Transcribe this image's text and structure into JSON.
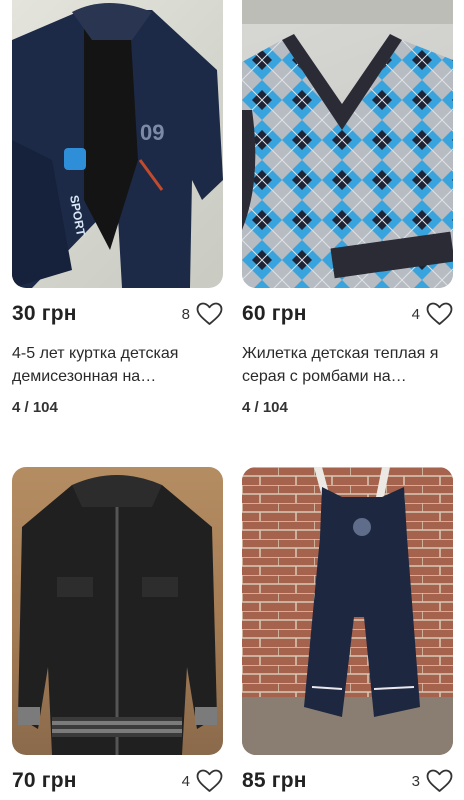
{
  "listings": [
    {
      "price": "30 грн",
      "likes": "8",
      "title": "4-5 лет куртка детская демисезонная на…",
      "size": "4 / 104",
      "image_icon": "jacket-sport-photo",
      "colors": {
        "garment": "#1c2a47",
        "accent": "#2f8ed8",
        "lining": "#141414"
      }
    },
    {
      "price": "60 грн",
      "likes": "4",
      "title": "Жилетка детская теплая я серая с ромбами на…",
      "size": "4 / 104",
      "image_icon": "argyle-vest-photo",
      "colors": {
        "base": "#b7bcc3",
        "blue": "#38a3dc",
        "navy": "#1e2434",
        "trim": "#2b2b36"
      }
    },
    {
      "price": "70 грн",
      "likes": "4",
      "title": "",
      "size": "",
      "image_icon": "leather-jacket-photo",
      "colors": {
        "garment": "#202020",
        "stripe": "#7b7b7b"
      }
    },
    {
      "price": "85 грн",
      "likes": "3",
      "title": "",
      "size": "",
      "image_icon": "snow-pants-photo",
      "colors": {
        "garment": "#1d2740",
        "brick": "#a5624d",
        "floor": "#8a7e72"
      }
    }
  ]
}
